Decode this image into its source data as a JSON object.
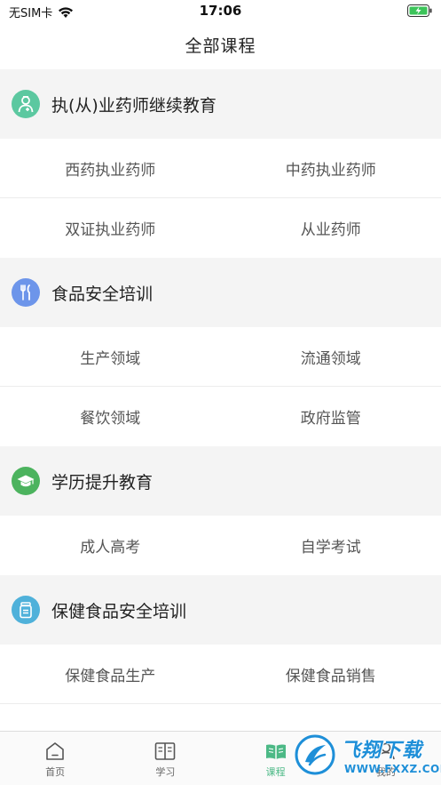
{
  "status": {
    "carrier": "无SIM卡",
    "time": "17:06"
  },
  "nav": {
    "title": "全部课程"
  },
  "sections": [
    {
      "title": "执(从)业药师继续教育",
      "icon": "pharmacist-icon",
      "color": "#5cc8a0",
      "rows": [
        [
          "西药执业药师",
          "中药执业药师"
        ],
        [
          "双证执业药师",
          "从业药师"
        ]
      ]
    },
    {
      "title": "食品安全培训",
      "icon": "fork-knife-icon",
      "color": "#6d95ea",
      "rows": [
        [
          "生产领域",
          "流通领域"
        ],
        [
          "餐饮领域",
          "政府监管"
        ]
      ]
    },
    {
      "title": "学历提升教育",
      "icon": "graduation-cap-icon",
      "color": "#4cb35e",
      "rows": [
        [
          "成人高考",
          "自学考试"
        ]
      ]
    },
    {
      "title": "保健食品安全培训",
      "icon": "health-jar-icon",
      "color": "#4fb1da",
      "rows": [
        [
          "保健食品生产",
          "保健食品销售"
        ]
      ]
    }
  ],
  "tabs": [
    {
      "label": "首页",
      "icon": "home-icon",
      "active": false
    },
    {
      "label": "学习",
      "icon": "book-icon",
      "active": false
    },
    {
      "label": "课程",
      "icon": "open-book-icon",
      "active": true
    },
    {
      "label": "我的",
      "icon": "user-icon",
      "active": false
    }
  ],
  "colors": {
    "accent": "#4cb986",
    "section_bg": "#f4f4f4",
    "watermark": "#1e8fd8"
  },
  "watermark": {
    "brand": "飞翔下载",
    "url": "WWW.FXXZ.COM"
  }
}
